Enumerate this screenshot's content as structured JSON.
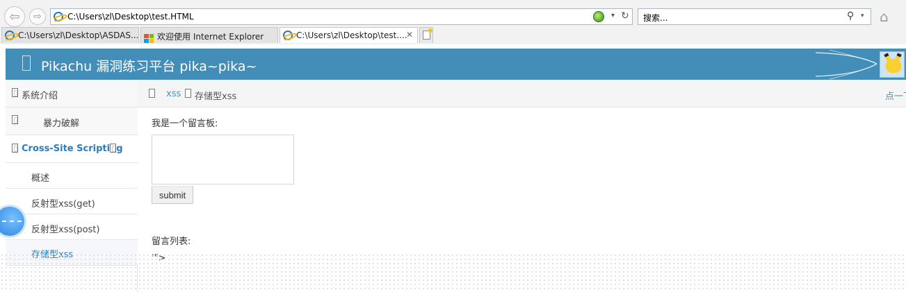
{
  "browser": {
    "address_url": "C:\\Users\\zl\\Desktop\\test.HTML",
    "search_placeholder": "搜索...",
    "tabs": [
      {
        "label": "C:\\Users\\zl\\Desktop\\ASDAS..."
      },
      {
        "label": "欢迎使用 Internet Explorer"
      },
      {
        "label": "C:\\Users\\zl\\Desktop\\test...."
      }
    ]
  },
  "header": {
    "title": "Pikachu 漏洞练习平台 pika~pika~"
  },
  "sidebar": {
    "items": [
      {
        "label": "系统介绍"
      },
      {
        "label": "暴力破解"
      },
      {
        "label": "Cross-Site Scripting"
      },
      {
        "label": "概述"
      },
      {
        "label": "反射型xss(get)"
      },
      {
        "label": "反射型xss(post)"
      },
      {
        "label": "存储型xss"
      }
    ]
  },
  "breadcrumb": {
    "parent": "xss",
    "current": "存储型xss",
    "hint": "点一下"
  },
  "content": {
    "board_label": "我是一个留言板:",
    "submit_label": "submit",
    "list_label": "留言列表:",
    "message_text": "'\">"
  },
  "colors": {
    "header_bg": "#438eb9",
    "link": "#2b7dbc"
  }
}
